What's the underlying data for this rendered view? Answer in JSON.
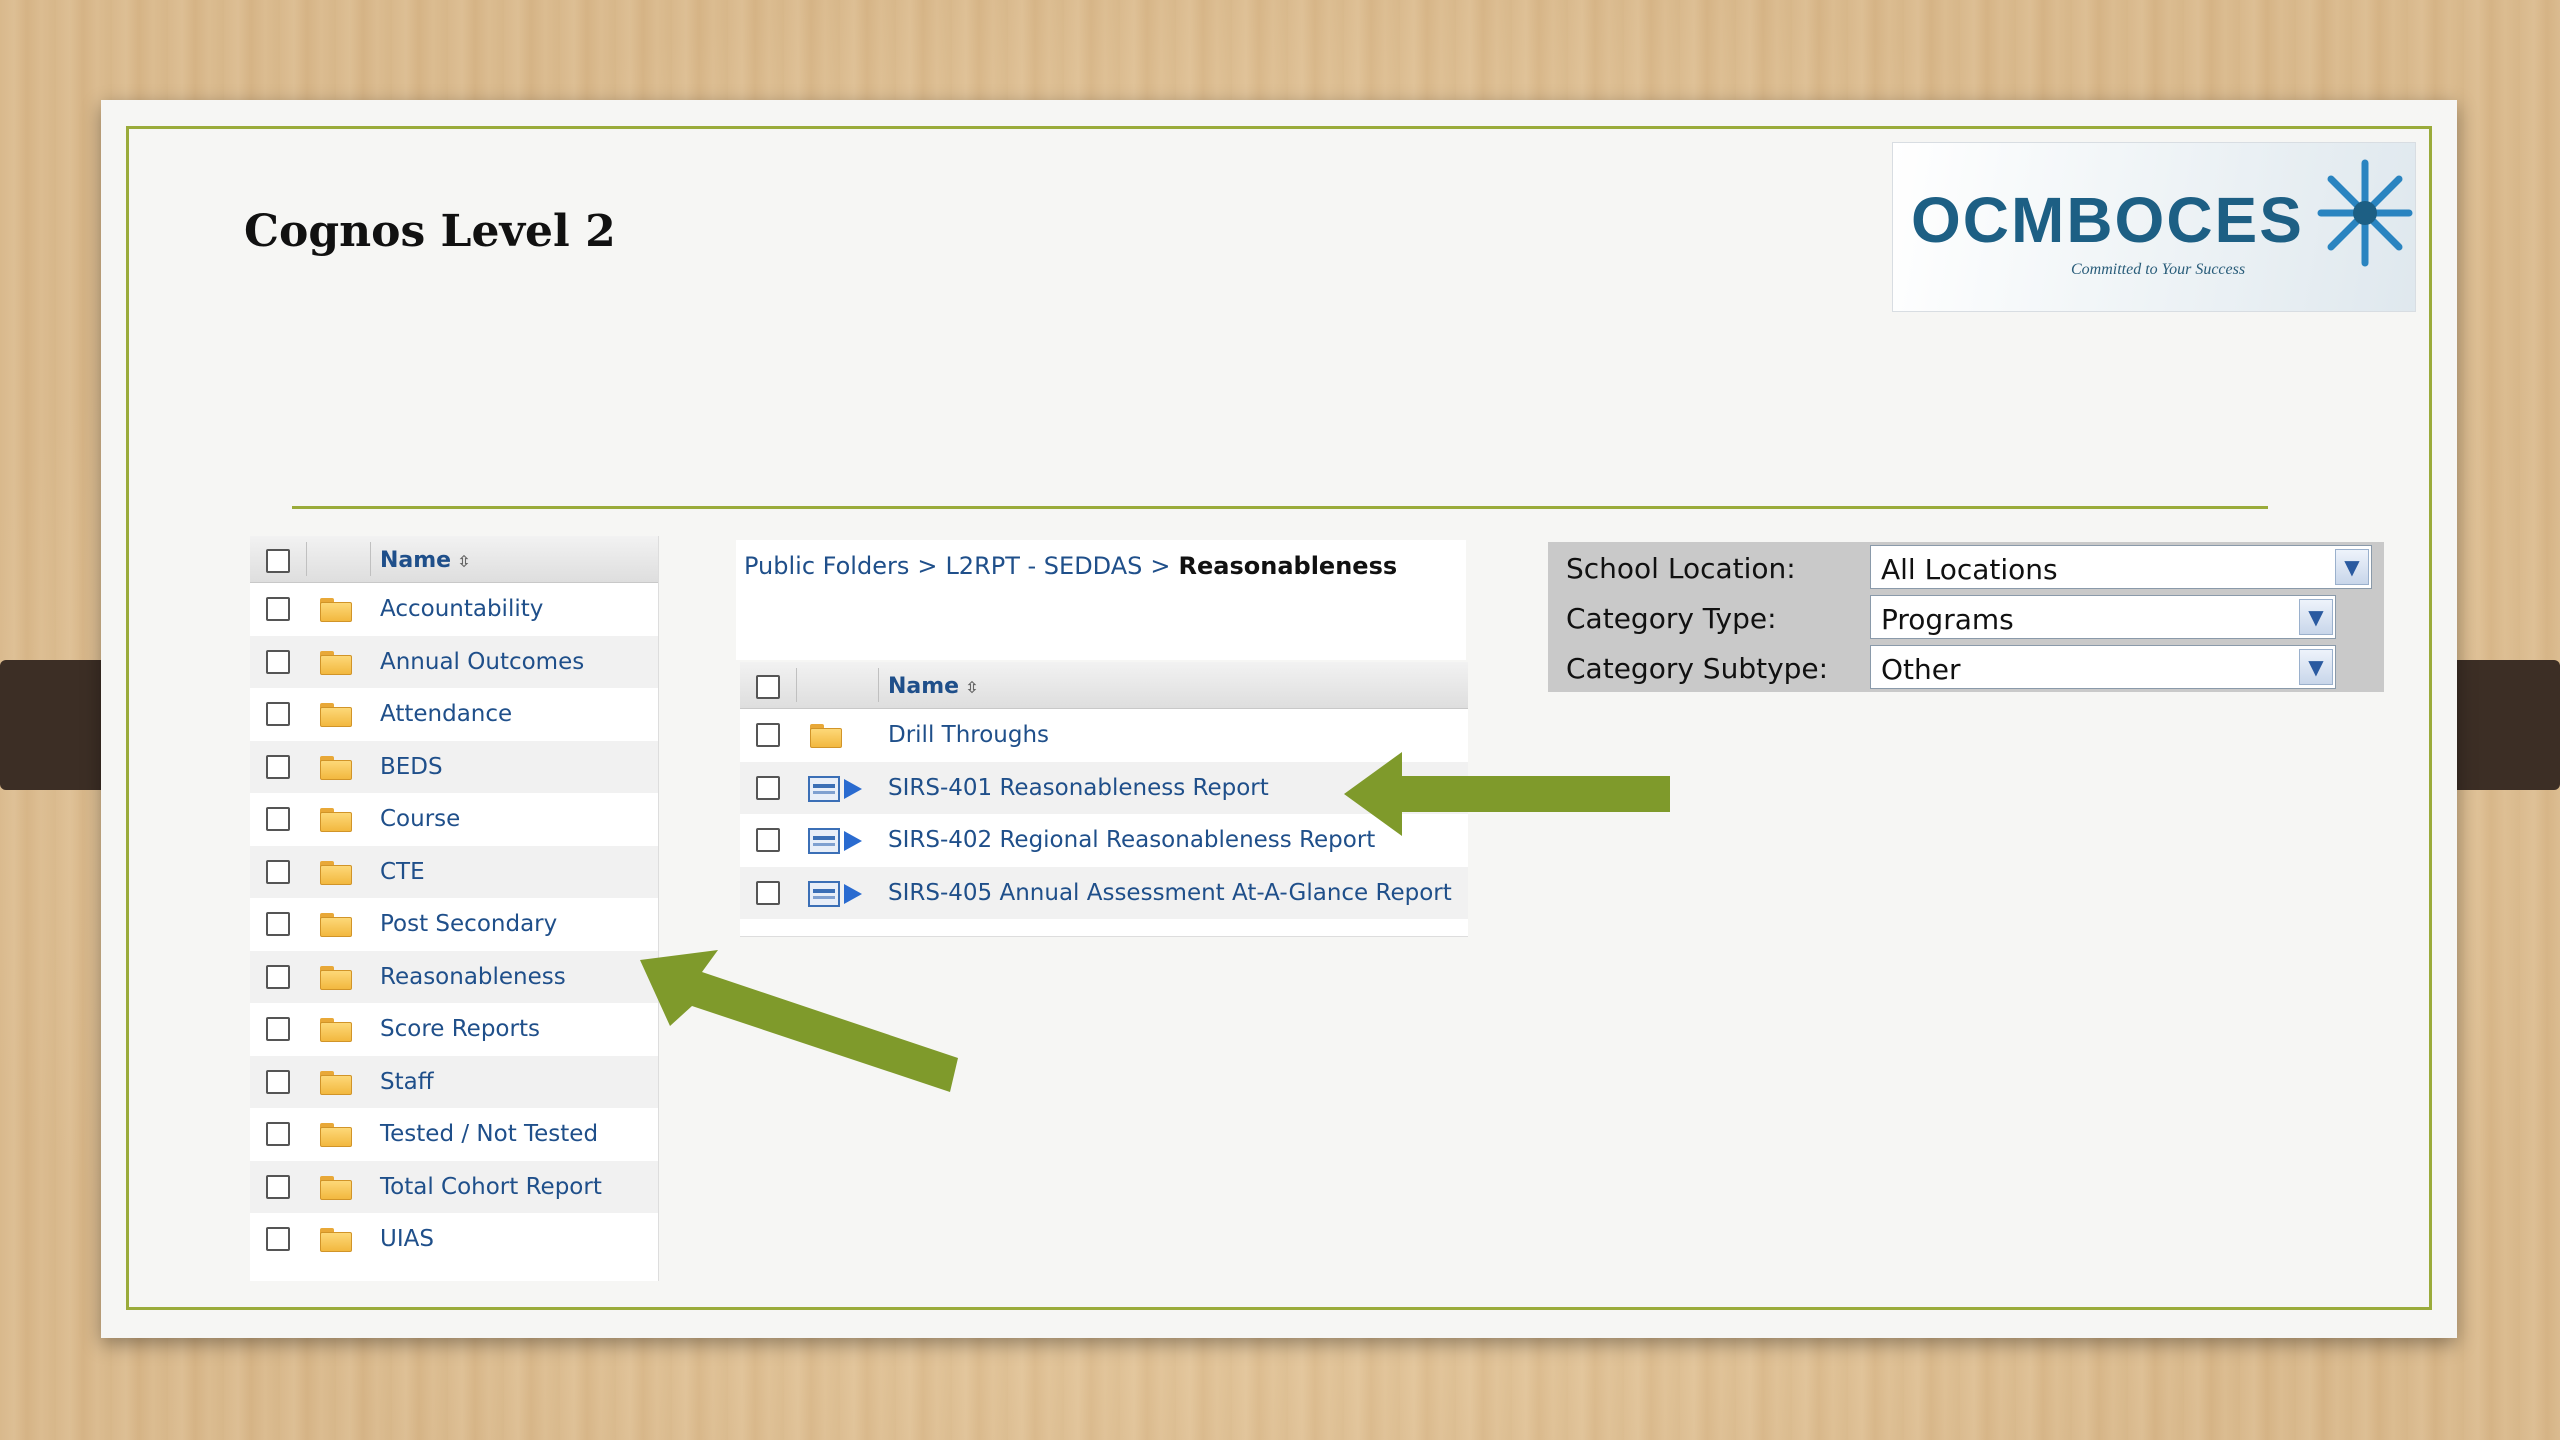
{
  "slide": {
    "title": "Cognos Level 2"
  },
  "logo": {
    "text": "OCMBOCES",
    "tagline": "Committed to Your Success"
  },
  "left_panel": {
    "header": "Name",
    "items": [
      "Accountability",
      "Annual Outcomes",
      "Attendance",
      "BEDS",
      "Course",
      "CTE",
      "Post Secondary",
      "Reasonableness",
      "Score Reports",
      "Staff",
      "Tested / Not Tested",
      "Total Cohort Report",
      "UIAS"
    ]
  },
  "breadcrumb": {
    "items": [
      "Public Folders",
      "L2RPT - SEDDAS"
    ],
    "separator": ">",
    "current": "Reasonableness"
  },
  "middle_panel": {
    "header": "Name",
    "items": [
      {
        "label": "Drill Throughs",
        "type": "folder"
      },
      {
        "label": "SIRS-401 Reasonableness Report",
        "type": "report"
      },
      {
        "label": "SIRS-402 Regional Reasonableness Report",
        "type": "report"
      },
      {
        "label": "SIRS-405 Annual Assessment At-A-Glance Report",
        "type": "report"
      }
    ]
  },
  "filters": {
    "school_location": {
      "label": "School Location:",
      "value": "All Locations"
    },
    "category_type": {
      "label": "Category Type:",
      "value": "Programs"
    },
    "category_subtype": {
      "label": "Category Subtype:",
      "value": "Other"
    }
  },
  "colors": {
    "accent_border": "#9aab3a",
    "arrow": "#7f9a2b",
    "link": "#1f4f8a",
    "logo": "#1d5f84"
  }
}
